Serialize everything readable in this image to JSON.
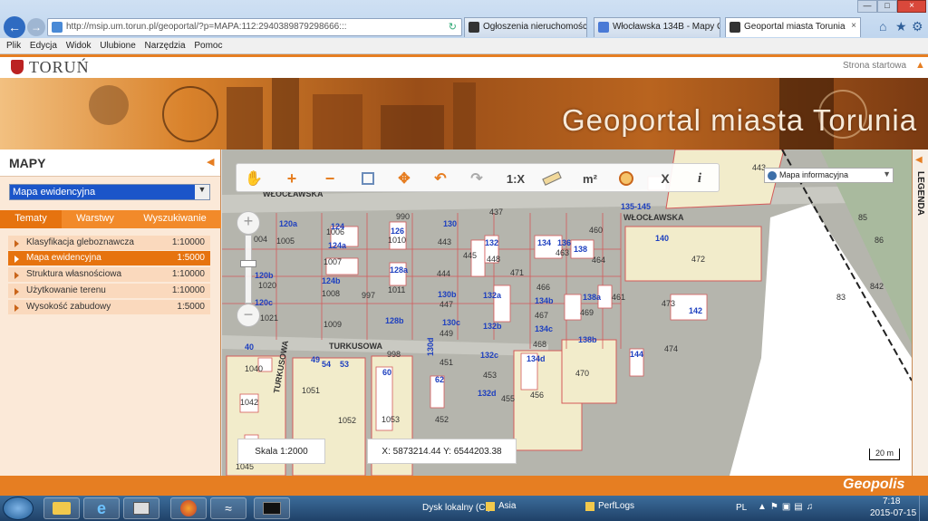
{
  "browser": {
    "address": "http://msip.um.torun.pl/geoportal/?p=MAPA:112:2940389879298666:::",
    "tabs": [
      {
        "label": "Ogłoszenia nieruchomości",
        "active": false
      },
      {
        "label": "Włocławska 134B - Mapy Go...",
        "active": false
      },
      {
        "label": "Geoportal miasta Torunia",
        "active": true
      }
    ],
    "menu": [
      "Plik",
      "Edycja",
      "Widok",
      "Ulubione",
      "Narzędzia",
      "Pomoc"
    ]
  },
  "site": {
    "logo_text": "TORUŃ",
    "home_link": "Strona startowa",
    "banner_title": "Geoportal miasta Torunia"
  },
  "sidebar": {
    "heading": "MAPY",
    "map_select": "Mapa ewidencyjna",
    "tabs": [
      "Tematy",
      "Warstwy",
      "Wyszukiwanie"
    ],
    "active_tab": "Tematy",
    "items": [
      {
        "label": "Klasyfikacja gleboznawcza",
        "scale": "1:10000",
        "selected": false
      },
      {
        "label": "Mapa ewidencyjna",
        "scale": "1:5000",
        "selected": true
      },
      {
        "label": "Struktura własnościowa",
        "scale": "1:10000",
        "selected": false
      },
      {
        "label": "Użytkowanie terenu",
        "scale": "1:10000",
        "selected": false
      },
      {
        "label": "Wysokość zabudowy",
        "scale": "1:5000",
        "selected": false
      }
    ]
  },
  "map": {
    "basemap_select": "Mapa informacyjna",
    "legend_label": "LEGENDA",
    "scale_text": "Skala 1:2000",
    "coords_text": "X: 5873214.44 Y: 6544203.38",
    "scalebar": "20 m",
    "toolbar": {
      "scale_tool": "1:X",
      "area_tool": "m²",
      "clear_tool": "X",
      "info_tool": "i"
    },
    "streets": [
      "WŁOCŁAWSKA",
      "WŁOCŁAWSKA",
      "TURKUSOWA",
      "TURKUSOWA"
    ],
    "labels_black": [
      "443",
      "004",
      "1005",
      "990",
      "437",
      "460",
      "472",
      "1006",
      "1010",
      "1007",
      "1011",
      "1008",
      "997",
      "1009",
      "443",
      "445",
      "448",
      "471",
      "466",
      "463",
      "464",
      "467",
      "469",
      "461",
      "468",
      "473",
      "474",
      "470",
      "453",
      "456",
      "455",
      "451",
      "452",
      "449",
      "447",
      "444",
      "998",
      "1051",
      "1052",
      "1053",
      "1040",
      "1042",
      "1045",
      "1020",
      "1021",
      "842",
      "83",
      "85",
      "86"
    ],
    "labels_blue": [
      "120a",
      "124a",
      "124",
      "126",
      "130",
      "132",
      "134",
      "136",
      "138",
      "135-145",
      "140",
      "120b",
      "120c",
      "124b",
      "128a",
      "130b",
      "132a",
      "134b",
      "138a",
      "142",
      "128b",
      "130c",
      "132b",
      "134c",
      "138b",
      "144",
      "40",
      "54",
      "53",
      "60",
      "62",
      "130d",
      "132c",
      "134d",
      "132d",
      "49"
    ]
  },
  "footer": {
    "brand": "Geopolis"
  },
  "taskbar": {
    "drive": "Dysk lokalny (C:)",
    "folders": [
      "Asia",
      "PerfLogs"
    ],
    "lang": "PL",
    "time": "7:18",
    "date": "2015-07-15"
  }
}
